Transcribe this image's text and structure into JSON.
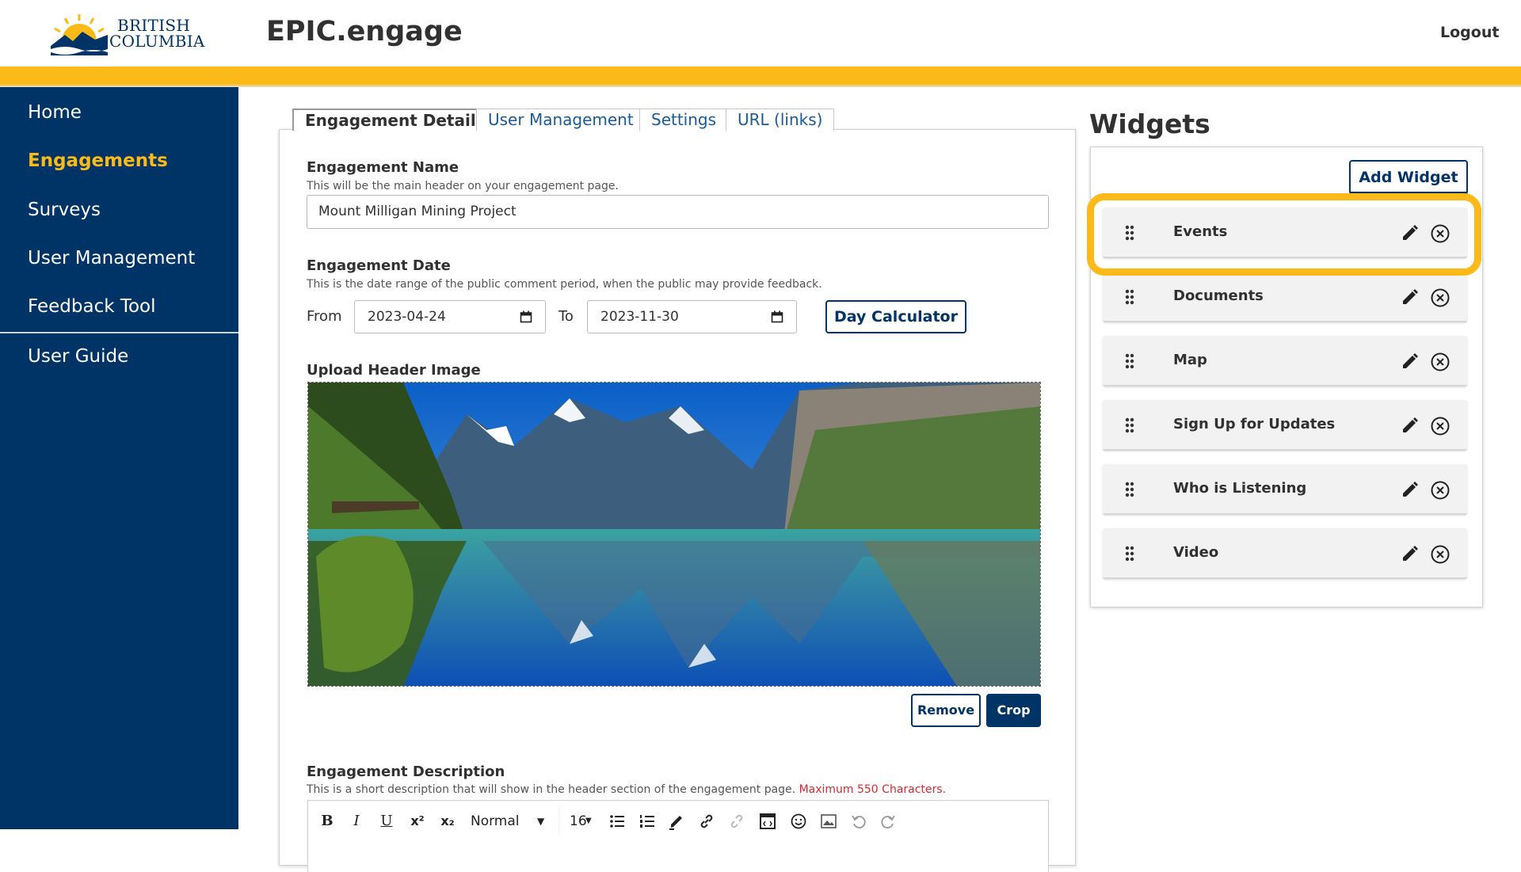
{
  "header": {
    "logo_line1": "BRITISH",
    "logo_line2": "COLUMBIA",
    "app_title": "EPIC.engage",
    "logout_label": "Logout"
  },
  "sidebar": {
    "items": [
      {
        "label": "Home"
      },
      {
        "label": "Engagements",
        "active": true
      },
      {
        "label": "Surveys"
      },
      {
        "label": "User Management"
      },
      {
        "label": "Feedback Tool"
      },
      {
        "label": "User Guide"
      }
    ]
  },
  "tabs": [
    {
      "label": "Engagement Details",
      "active": true
    },
    {
      "label": "User Management"
    },
    {
      "label": "Settings"
    },
    {
      "label": "URL (links)"
    }
  ],
  "form": {
    "name": {
      "label": "Engagement Name",
      "help": "This will be the main header on your engagement page.",
      "value": "Mount Milligan Mining Project"
    },
    "date": {
      "label": "Engagement Date",
      "help": "This is the date range of the public comment period, when the public may provide feedback.",
      "from_label": "From",
      "from_value": "2023-04-24",
      "to_label": "To",
      "to_value": "2023-11-30",
      "calculator_label": "Day Calculator"
    },
    "image": {
      "label": "Upload Header Image",
      "remove_label": "Remove",
      "crop_label": "Crop"
    },
    "description": {
      "label": "Engagement Description",
      "help": "This is a short description that will show in the header section of the engagement page. ",
      "limit_warning": "Maximum 550 Characters."
    },
    "toolbar": {
      "bold": "B",
      "italic": "I",
      "underline": "U",
      "superscript": "x²",
      "subscript": "x₂",
      "block_type": "Normal",
      "font_size": "16"
    }
  },
  "widgets": {
    "title": "Widgets",
    "add_label": "Add Widget",
    "items": [
      {
        "name": "Events",
        "highlighted": true
      },
      {
        "name": "Documents"
      },
      {
        "name": "Map"
      },
      {
        "name": "Sign Up for Updates"
      },
      {
        "name": "Who is Listening"
      },
      {
        "name": "Video"
      }
    ]
  },
  "colors": {
    "brand_navy": "#003366",
    "brand_gold": "#fcba19",
    "link_blue": "#1a5a96",
    "warning_red": "#d8292f"
  }
}
